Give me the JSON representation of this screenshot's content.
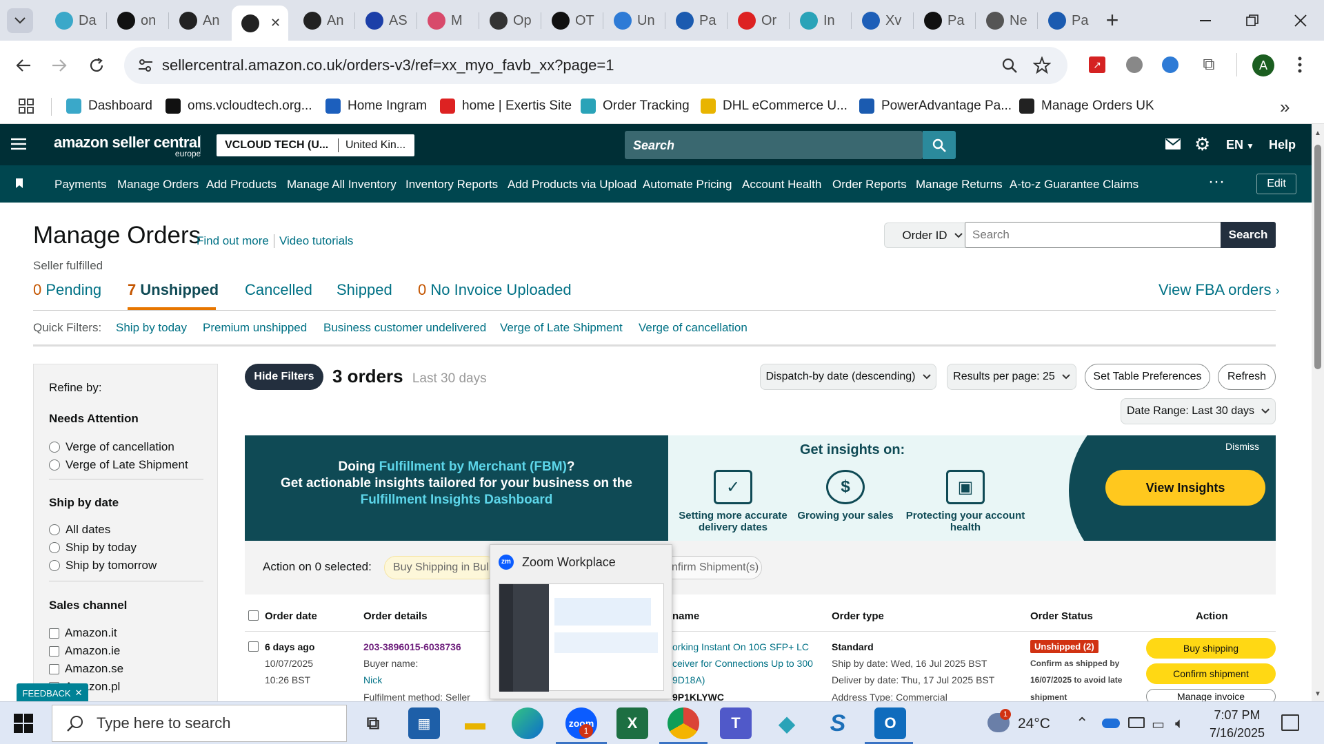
{
  "browser": {
    "tabs": [
      {
        "label": "Da",
        "icon": "gem-icon",
        "color": "#3aa8c9"
      },
      {
        "label": "on",
        "icon": "circle-logo-icon",
        "color": "#111"
      },
      {
        "label": "An",
        "icon": "amazon-icon",
        "color": "#222"
      },
      {
        "label": "",
        "icon": "amazon-icon",
        "color": "#222",
        "active": true
      },
      {
        "label": "An",
        "icon": "amazon-icon",
        "color": "#222"
      },
      {
        "label": "AS",
        "icon": "arrow-icon",
        "color": "#1c3fa8"
      },
      {
        "label": "M",
        "icon": "rings-icon",
        "color": "#d84a6b"
      },
      {
        "label": "Op",
        "icon": "openai-icon",
        "color": "#333"
      },
      {
        "label": "OT",
        "icon": "openai-icon",
        "color": "#111"
      },
      {
        "label": "Un",
        "icon": "globe-icon",
        "color": "#2e7bd6"
      },
      {
        "label": "Pa",
        "icon": "e-icon",
        "color": "#1b5bb0"
      },
      {
        "label": "Or",
        "icon": "exertis-icon",
        "color": "#d22"
      },
      {
        "label": "In",
        "icon": "c-icon",
        "color": "#2aa3b8"
      },
      {
        "label": "Xv",
        "icon": "wave-icon",
        "color": "#1e5fb8"
      },
      {
        "label": "Pa",
        "icon": "avatar-icon",
        "color": "#111"
      },
      {
        "label": "Ne",
        "icon": "openai-icon",
        "color": "#555"
      },
      {
        "label": "Pa",
        "icon": "e-icon",
        "color": "#1b5bb0"
      }
    ],
    "url": "sellercentral.amazon.co.uk/orders-v3/ref=xx_myo_favb_xx?page=1",
    "profile_initial": "A",
    "bookmarks": [
      {
        "label": "Dashboard",
        "color": "#3aa8c9"
      },
      {
        "label": "oms.vcloudtech.org...",
        "color": "#111"
      },
      {
        "label": "Home Ingram",
        "color": "#1c5fbd"
      },
      {
        "label": "home | Exertis Site",
        "color": "#d22"
      },
      {
        "label": "Order Tracking",
        "color": "#2aa3b8"
      },
      {
        "label": "DHL eCommerce U...",
        "color": "#e8b400"
      },
      {
        "label": "PowerAdvantage Pa...",
        "color": "#1b5bb0"
      },
      {
        "label": "Manage Orders UK",
        "color": "#222"
      }
    ]
  },
  "seller": {
    "logo_main": "amazon seller central",
    "logo_sub": "europe",
    "account": "VCLOUD TECH (U...",
    "marketplace": "United Kin...",
    "search_placeholder": "Search",
    "lang": "EN",
    "help": "Help",
    "nav": [
      "Payments",
      "Manage Orders",
      "Add Products",
      "Manage All Inventory",
      "Inventory Reports",
      "Add Products via Upload",
      "Automate Pricing",
      "Account Health",
      "Order Reports",
      "Manage Returns",
      "A-to-z Guarantee Claims"
    ],
    "edit": "Edit"
  },
  "page": {
    "title": "Manage Orders",
    "find_out_more": "Find out more",
    "video_tutorials": "Video tutorials",
    "subtitle": "Seller fulfilled",
    "order_id_select": "Order ID",
    "search_placeholder": "Search",
    "search_button": "Search",
    "tabs": {
      "pending_count": "0",
      "pending": "Pending",
      "unshipped_count": "7",
      "unshipped": "Unshipped",
      "cancelled": "Cancelled",
      "shipped": "Shipped",
      "noinvoice_count": "0",
      "noinvoice": "No Invoice Uploaded",
      "fba": "View FBA orders"
    },
    "quick_filters_label": "Quick Filters:",
    "quick_filters": [
      "Ship by today",
      "Premium unshipped",
      "Business customer undelivered",
      "Verge of Late Shipment",
      "Verge of cancellation"
    ],
    "hide_filters": "Hide Filters",
    "orders_count": "3 orders",
    "orders_range": "Last 30 days",
    "sort": "Dispatch-by date (descending)",
    "per_page": "Results per page: 25",
    "table_prefs": "Set Table Preferences",
    "refresh": "Refresh",
    "date_range": "Date Range: Last 30 days"
  },
  "refine": {
    "title": "Refine by:",
    "needs_attention": "Needs Attention",
    "needs_options": [
      "Verge of cancellation",
      "Verge of Late Shipment"
    ],
    "ship_by": "Ship by date",
    "ship_options": [
      "All dates",
      "Ship by today",
      "Ship by tomorrow"
    ],
    "sales_channel": "Sales channel",
    "channels": [
      "Amazon.it",
      "Amazon.ie",
      "Amazon.se",
      "Amazon.pl"
    ]
  },
  "banner": {
    "line1_pre": "Doing ",
    "line1_link": "Fulfillment by Merchant (FBM)",
    "line1_post": "?",
    "line2": "Get actionable insights tailored for your business on the",
    "line3": "Fulfillment Insights Dashboard",
    "insights_title": "Get insights on:",
    "items": [
      "Setting more accurate delivery dates",
      "Growing your sales",
      "Protecting your account health"
    ],
    "dismiss": "Dismiss",
    "cta": "View Insights"
  },
  "actionbar": {
    "label": "Action on 0 selected:",
    "buy_bulk": "Buy Shipping in Bul",
    "confirm": "nfirm Shipment(s)"
  },
  "table": {
    "headers": [
      "Order date",
      "Order details",
      "name",
      "Order type",
      "Order Status",
      "Action"
    ],
    "row": {
      "ago": "6 days ago",
      "date": "10/07/2025",
      "time": "10:26 BST",
      "order_id": "203-3896015-6038736",
      "buyer_label": "Buyer name:",
      "buyer": "Nick",
      "fulfil": "Fulfilment method: Seller",
      "product1": "orking Instant On 10G SFP+ LC",
      "product2": "ceiver for Connections Up to 300",
      "product3": "9D18A)",
      "asin": "9P1KLYWC",
      "type": "Standard",
      "ship_by": "Ship by date: Wed, 16 Jul 2025 BST",
      "deliver_by": "Deliver by date: Thu, 17 Jul 2025 BST",
      "address": "Address Type:  Commercial",
      "status_badge": "Unshipped (2)",
      "status_note1": "Confirm as shipped by",
      "status_note2": "16/07/2025 to avoid late",
      "status_note3": "shipment",
      "buy_shipping": "Buy shipping",
      "confirm_shipment": "Confirm shipment",
      "manage_invoice": "Manage invoice"
    }
  },
  "feedback": "FEEDBACK",
  "zoom_popup": {
    "title": "Zoom Workplace"
  },
  "taskbar": {
    "search_placeholder": "Type here to search",
    "zoom_badge": "1",
    "weather_badge": "1",
    "temperature": "24°C",
    "time": "7:07 PM",
    "date": "7/16/2025"
  }
}
